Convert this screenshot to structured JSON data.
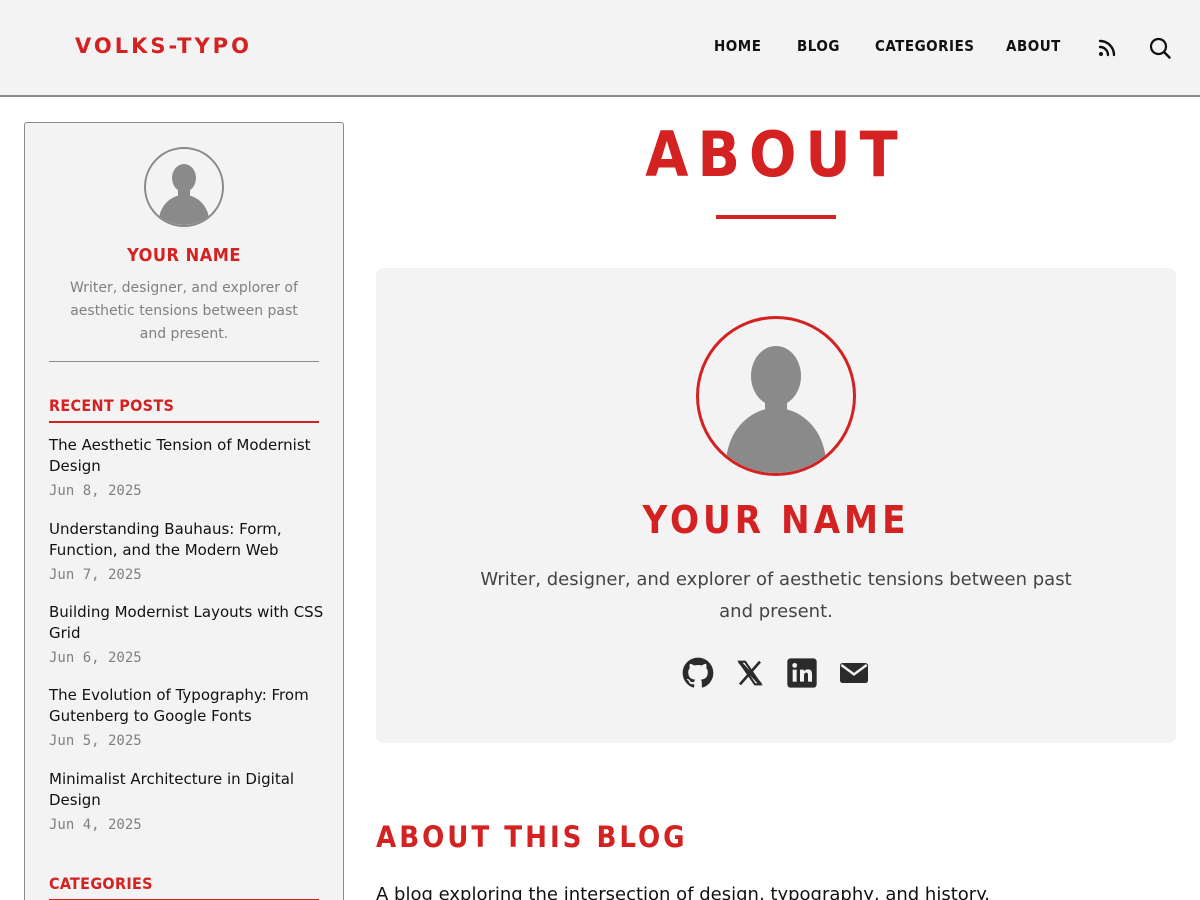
{
  "header": {
    "logo": "VOLKS-TYPO",
    "nav": [
      "HOME",
      "BLOG",
      "CATEGORIES",
      "ABOUT"
    ],
    "icons": [
      "rss-icon",
      "search-icon"
    ]
  },
  "sidebar": {
    "name": "YOUR NAME",
    "bio": "Writer, designer, and explorer of aesthetic tensions between past and present.",
    "recent_heading": "RECENT POSTS",
    "posts": [
      {
        "title": "The Aesthetic Tension of Modernist Design",
        "date": "Jun 8, 2025"
      },
      {
        "title": "Understanding Bauhaus: Form, Function, and the Modern Web",
        "date": "Jun 7, 2025"
      },
      {
        "title": "Building Modernist Layouts with CSS Grid",
        "date": "Jun 6, 2025"
      },
      {
        "title": "The Evolution of Typography: From Gutenberg to Google Fonts",
        "date": "Jun 5, 2025"
      },
      {
        "title": "Minimalist Architecture in Digital Design",
        "date": "Jun 4, 2025"
      }
    ],
    "categories_heading": "CATEGORIES"
  },
  "main": {
    "title": "ABOUT",
    "card": {
      "name": "YOUR NAME",
      "bio": "Writer, designer, and explorer of aesthetic tensions between past and present.",
      "social_icons": [
        "github-icon",
        "x-icon",
        "linkedin-icon",
        "email-icon"
      ]
    },
    "section_title": "ABOUT THIS BLOG",
    "section_text": "A blog exploring the intersection of design, typography, and history."
  },
  "colors": {
    "accent": "#d42121",
    "panel_bg": "#f3f3f3",
    "muted_text": "#808080",
    "border": "#8a8a8a"
  }
}
